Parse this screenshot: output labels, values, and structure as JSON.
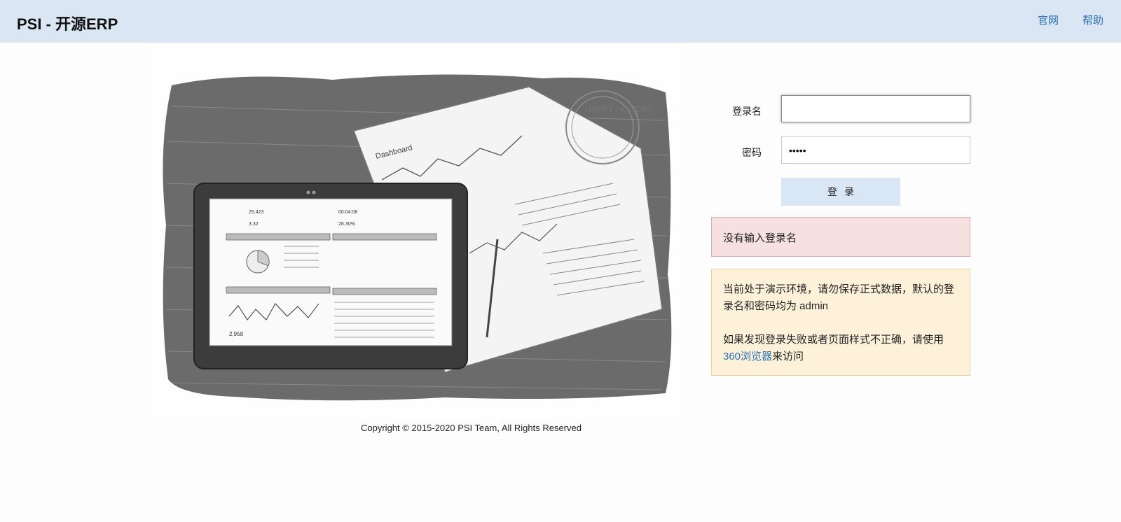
{
  "header": {
    "brand": "PSI - 开源ERP",
    "nav": [
      "官网",
      "帮助"
    ]
  },
  "login": {
    "username_label": "登录名",
    "username_value": "",
    "password_label": "密码",
    "password_value": "admin",
    "submit_label": "登录"
  },
  "error_message": "没有输入登录名",
  "notice": {
    "line1": "当前处于演示环境，请勿保存正式数据，默认的登录名和密码均为 admin",
    "line2_before": "如果发现登录失败或者页面样式不正确，请使用",
    "line2_link": "360浏览器",
    "line2_after": "来访问"
  },
  "illustration": {
    "tablet_stats": [
      "25,423",
      "00:04:08",
      "3.32",
      "28.30%"
    ],
    "paper_title": "Dashboard",
    "stamp_text": "HAPPY HOLIDAY",
    "visits": "2,958"
  },
  "footer": {
    "copyright": "Copyright © 2015-2020 PSI Team, All Rights Reserved"
  },
  "colors": {
    "header_bg": "#dae6f4",
    "link": "#2a6fb0",
    "error_bg": "#f6e0e0",
    "notice_bg": "#fdf1d9",
    "button_bg": "#d9e6f5"
  }
}
